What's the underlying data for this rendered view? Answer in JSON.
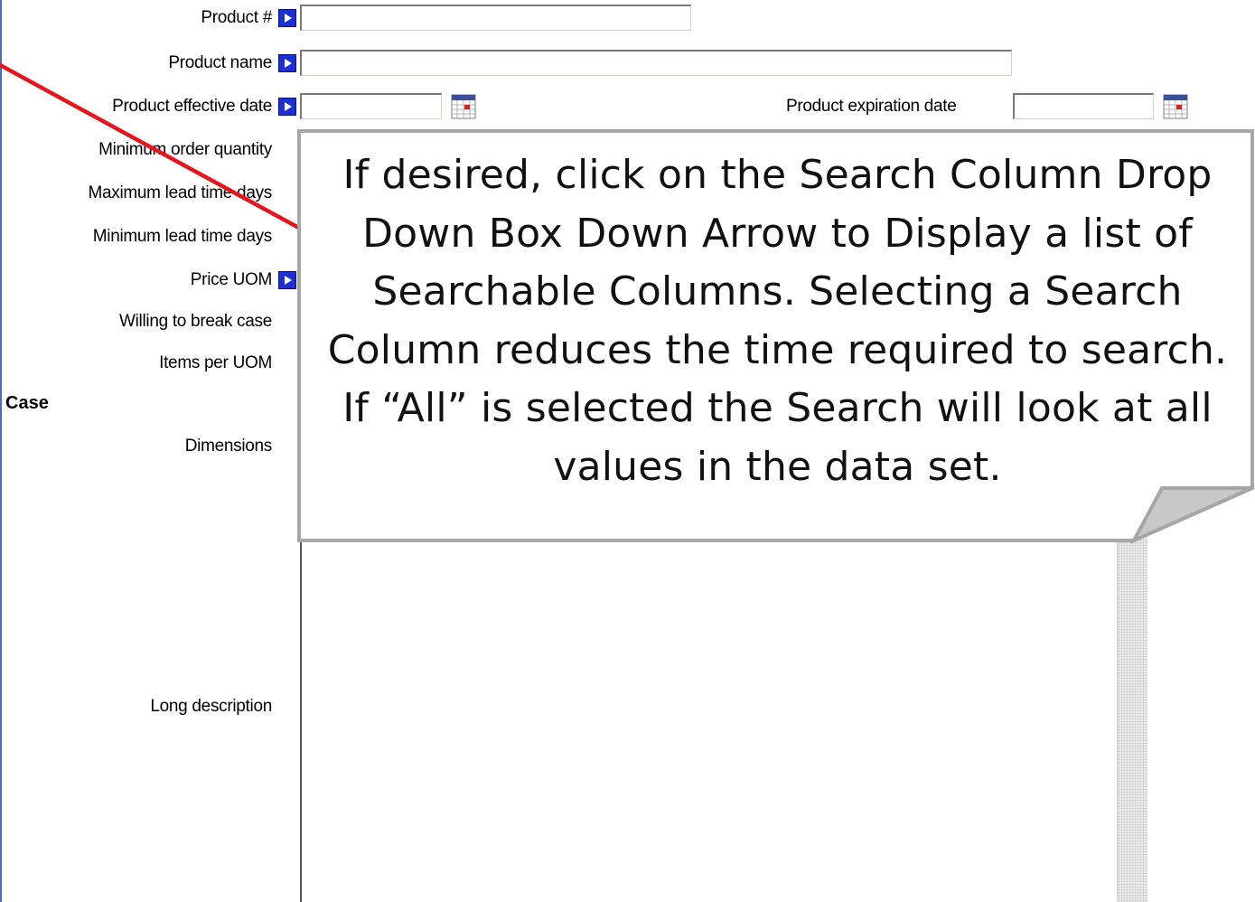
{
  "form": {
    "labels": {
      "product_number": "Product #",
      "product_name": "Product name",
      "effective_date": "Product effective date",
      "expiration_date": "Product expiration date",
      "min_order_qty": "Minimum order quantity",
      "max_lead_time": "Maximum lead time days",
      "min_lead_time": "Minimum lead time days",
      "price_uom": "Price UOM",
      "break_case": "Willing to break case",
      "items_per_uom": "Items per UOM",
      "dimensions": "Dimensions",
      "long_description": "Long description"
    },
    "sections": {
      "case": "Case"
    },
    "values": {
      "product_number": "",
      "product_name": "",
      "effective_date": "",
      "expiration_date": ""
    }
  },
  "callout": {
    "text": "If desired, click on the Search Column Drop Down Box Down Arrow to Display a list of Searchable Columns. Selecting a Search Column reduces the time required to search. If “All” is selected the Search will look at all values in the data set."
  },
  "icons": {
    "lookup": "lookup-arrow-icon",
    "calendar": "calendar-icon"
  },
  "colors": {
    "lookup_button": "#1c2fd6",
    "pointer_line": "#e8141c",
    "callout_fill": "#ffffff",
    "callout_border": "#a6a6a6"
  }
}
